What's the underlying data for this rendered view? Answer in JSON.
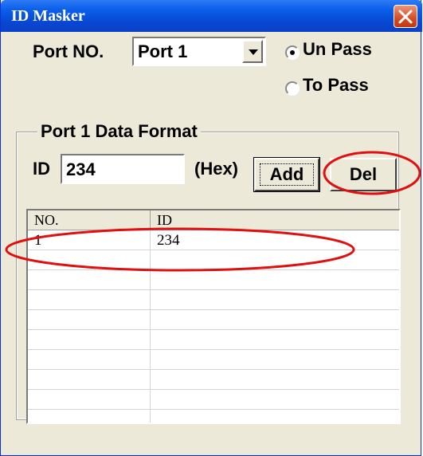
{
  "window": {
    "title": "ID Masker"
  },
  "port": {
    "label": "Port NO.",
    "selected": "Port 1"
  },
  "mode": {
    "options": [
      "Un Pass",
      "To Pass"
    ],
    "selected": "Un Pass"
  },
  "group": {
    "label": "Port 1 Data Format"
  },
  "id_input": {
    "label": "ID",
    "value": "234",
    "unit_label": "(Hex)"
  },
  "buttons": {
    "add": "Add",
    "del": "Del"
  },
  "table": {
    "columns": [
      "NO.",
      "ID"
    ],
    "rows": [
      [
        "1",
        "234"
      ]
    ],
    "empty_rows": 9
  },
  "annotations": {
    "color": "#e01010"
  }
}
